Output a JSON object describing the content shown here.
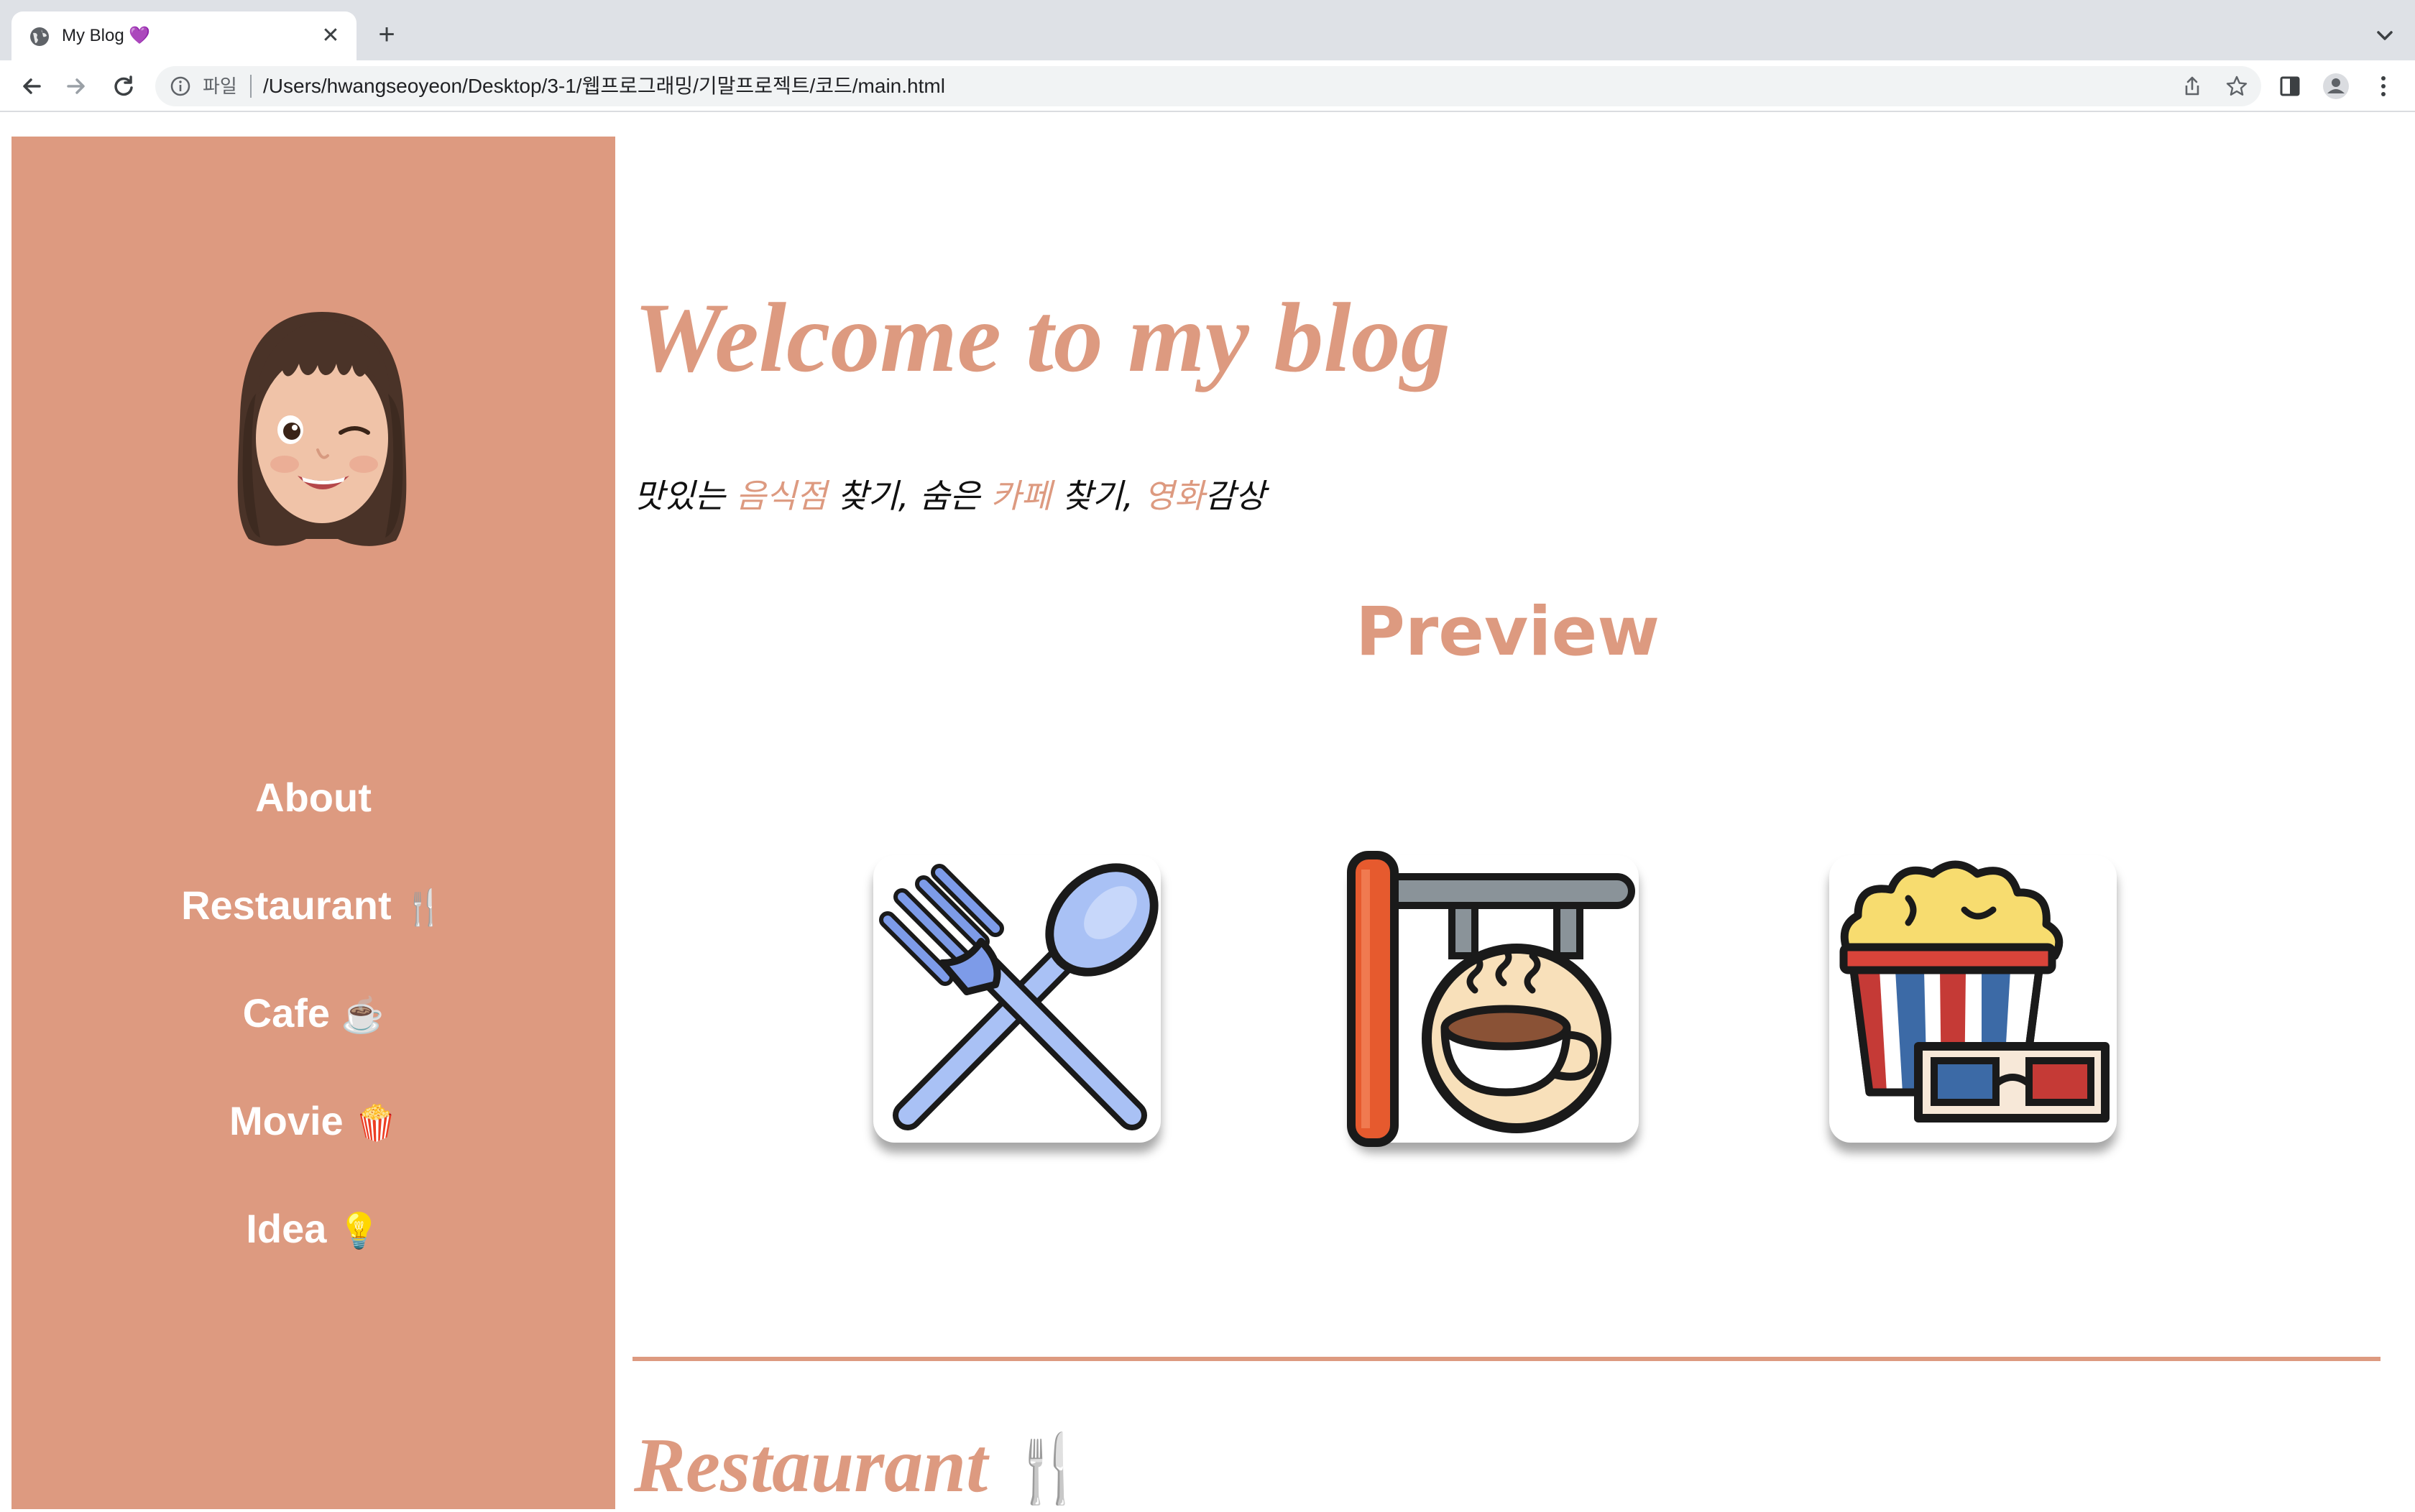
{
  "browser": {
    "tab_title": "My Blog 💜",
    "close_glyph": "✕",
    "new_tab_glyph": "+",
    "address_scheme": "파일",
    "address_url": "/Users/hwangseoyeon/Desktop/3-1/웹프로그래밍/기말프로젝트/코드/main.html"
  },
  "sidebar": {
    "avatar_icon": "memoji-avatar",
    "items": [
      {
        "label": "About",
        "emoji": ""
      },
      {
        "label": "Restaurant",
        "emoji": "🍴"
      },
      {
        "label": "Cafe",
        "emoji": "☕"
      },
      {
        "label": "Movie",
        "emoji": "🍿"
      },
      {
        "label": "Idea",
        "emoji": "💡"
      }
    ]
  },
  "main": {
    "title": "Welcome to my blog",
    "tagline": {
      "p1": "맛있는 ",
      "food": "음식점",
      "p2": " 찾기, 숨은 ",
      "cafe": "카페",
      "p3": " 찾기, ",
      "movie": "영화",
      "p4": "감상"
    },
    "preview_title": "Preview",
    "cards": [
      {
        "icon": "fork-spoon-icon"
      },
      {
        "icon": "cafe-sign-icon"
      },
      {
        "icon": "popcorn-3d-glasses-icon"
      }
    ],
    "section_title": "Restaurant",
    "section_emoji": "🍴"
  },
  "colors": {
    "accent": "#dd9a80",
    "chrome_bg": "#dee1e6",
    "omnibox_bg": "#f1f3f4"
  }
}
